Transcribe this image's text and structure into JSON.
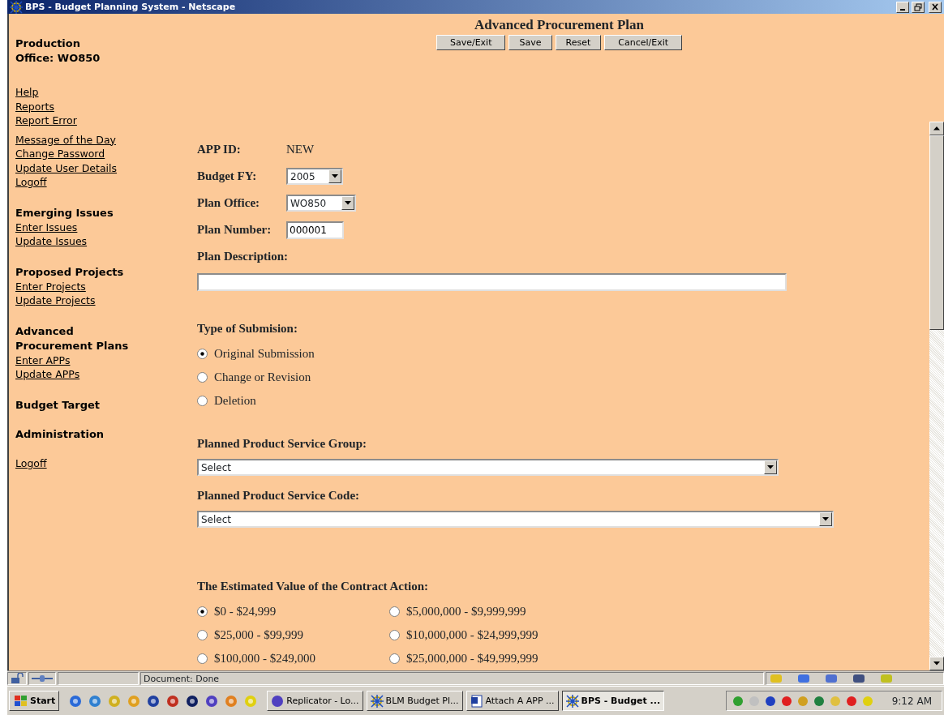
{
  "window": {
    "title": "BPS - Budget Planning System - Netscape"
  },
  "sidebar": {
    "header_lines": [
      "Production",
      "Office: WO850"
    ],
    "groups": [
      {
        "links": [
          "Help",
          "Reports",
          "Report Error"
        ]
      },
      {
        "links": [
          "Message of the Day",
          "Change Password",
          "Update User Details",
          "Logoff"
        ]
      },
      {
        "heading": "Emerging Issues",
        "links": [
          "Enter Issues",
          "Update Issues"
        ]
      },
      {
        "heading": "Proposed Projects",
        "links": [
          "Enter Projects",
          "Update Projects"
        ]
      },
      {
        "heading": "Advanced Procurement Plans",
        "links": [
          "Enter APPs",
          "Update APPs"
        ]
      },
      {
        "heading": "Budget Target"
      },
      {
        "heading": "Administration"
      },
      {
        "links": [
          "Logoff"
        ]
      }
    ]
  },
  "header": {
    "title": "Advanced Procurement Plan",
    "buttons": [
      "Save/Exit",
      "Save",
      "Reset",
      "Cancel/Exit"
    ]
  },
  "form": {
    "app_id": {
      "label": "APP ID:",
      "value": "NEW"
    },
    "budget_fy": {
      "label": "Budget FY:",
      "value": "2005"
    },
    "plan_office": {
      "label": "Plan Office:",
      "value": "WO850"
    },
    "plan_number": {
      "label": "Plan Number:",
      "value": "000001"
    },
    "plan_description": {
      "label": "Plan Description:"
    },
    "submission_type": {
      "label": "Type of Submision:",
      "options": [
        {
          "label": "Original Submission",
          "selected": true
        },
        {
          "label": "Change or Revision",
          "selected": false
        },
        {
          "label": "Deletion",
          "selected": false
        }
      ]
    },
    "service_group": {
      "label": "Planned Product Service Group:",
      "value": "Select"
    },
    "service_code": {
      "label": "Planned Product Service Code:",
      "value": "Select"
    },
    "estimated_value": {
      "label": "The Estimated Value of the Contract Action:",
      "options": [
        {
          "label": "$0 - $24,999",
          "selected": true
        },
        {
          "label": "$5,000,000 - $9,999,999",
          "selected": false
        },
        {
          "label": "$25,000 - $99,999",
          "selected": false
        },
        {
          "label": "$10,000,000 - $24,999,999",
          "selected": false
        },
        {
          "label": "$100,000 - $249,000",
          "selected": false
        },
        {
          "label": "$25,000,000 - $49,999,999",
          "selected": false
        }
      ]
    }
  },
  "status_bar": {
    "text": "Document: Done"
  },
  "taskbar": {
    "start": "Start",
    "tasks": [
      {
        "label": "Replicator - Lo...",
        "selected": false
      },
      {
        "label": "BLM Budget Pl...",
        "selected": false
      },
      {
        "label": "Attach A APP ...",
        "selected": false
      },
      {
        "label": "BPS - Budget ...",
        "selected": true
      }
    ],
    "clock": "9:12 AM"
  }
}
